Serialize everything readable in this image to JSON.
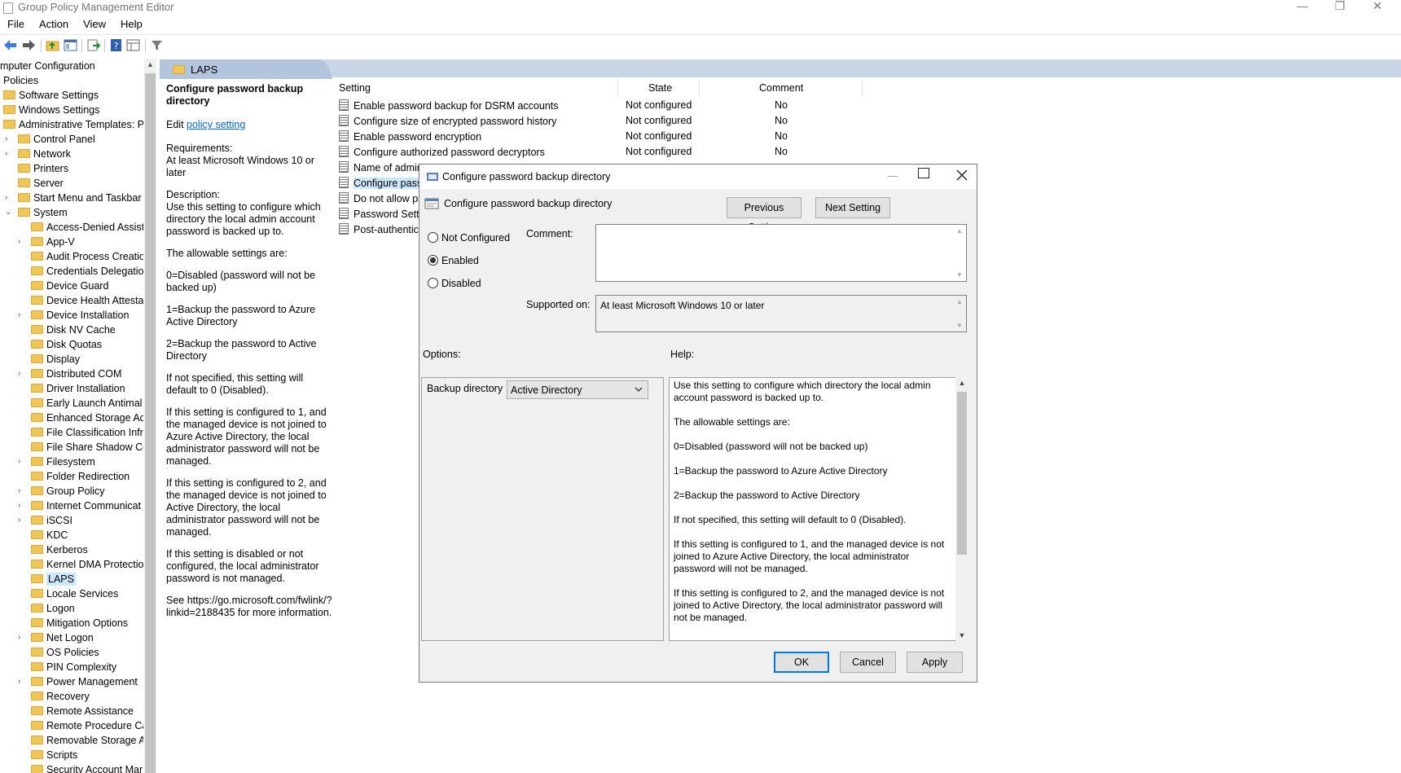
{
  "window": {
    "title": "Group Policy Management Editor",
    "minimize": "—",
    "restore": "❐",
    "close": "✕"
  },
  "menu": [
    "File",
    "Action",
    "View",
    "Help"
  ],
  "tree": {
    "root_items": [
      {
        "label": "mputer Configuration"
      },
      {
        "label": "Policies"
      },
      {
        "label": "Software Settings"
      },
      {
        "label": "Windows Settings"
      },
      {
        "label": "Administrative Templates: Po"
      }
    ],
    "level1": [
      {
        "label": "Control Panel",
        "expander": "›"
      },
      {
        "label": "Network",
        "expander": "›"
      },
      {
        "label": "Printers",
        "expander": ""
      },
      {
        "label": "Server",
        "expander": ""
      },
      {
        "label": "Start Menu and Taskbar",
        "expander": "›"
      },
      {
        "label": "System",
        "expander": "⌄"
      }
    ],
    "system_children": [
      {
        "label": "Access-Denied Assista",
        "expander": ""
      },
      {
        "label": "App-V",
        "expander": "›"
      },
      {
        "label": "Audit Process Creatio",
        "expander": ""
      },
      {
        "label": "Credentials Delegatio",
        "expander": ""
      },
      {
        "label": "Device Guard",
        "expander": ""
      },
      {
        "label": "Device Health Attesta",
        "expander": ""
      },
      {
        "label": "Device Installation",
        "expander": "›"
      },
      {
        "label": "Disk NV Cache",
        "expander": ""
      },
      {
        "label": "Disk Quotas",
        "expander": ""
      },
      {
        "label": "Display",
        "expander": ""
      },
      {
        "label": "Distributed COM",
        "expander": "›"
      },
      {
        "label": "Driver Installation",
        "expander": ""
      },
      {
        "label": "Early Launch Antimal",
        "expander": ""
      },
      {
        "label": "Enhanced Storage Ac",
        "expander": ""
      },
      {
        "label": "File Classification Infr",
        "expander": ""
      },
      {
        "label": "File Share Shadow Co",
        "expander": ""
      },
      {
        "label": "Filesystem",
        "expander": "›"
      },
      {
        "label": "Folder Redirection",
        "expander": ""
      },
      {
        "label": "Group Policy",
        "expander": "›"
      },
      {
        "label": "Internet Communicat",
        "expander": "›"
      },
      {
        "label": "iSCSI",
        "expander": "›"
      },
      {
        "label": "KDC",
        "expander": ""
      },
      {
        "label": "Kerberos",
        "expander": ""
      },
      {
        "label": "Kernel DMA Protectio",
        "expander": ""
      },
      {
        "label": "LAPS",
        "expander": "",
        "selected": true
      },
      {
        "label": "Locale Services",
        "expander": ""
      },
      {
        "label": "Logon",
        "expander": ""
      },
      {
        "label": "Mitigation Options",
        "expander": ""
      },
      {
        "label": "Net Logon",
        "expander": "›"
      },
      {
        "label": "OS Policies",
        "expander": ""
      },
      {
        "label": "PIN Complexity",
        "expander": ""
      },
      {
        "label": "Power Management",
        "expander": "›"
      },
      {
        "label": "Recovery",
        "expander": ""
      },
      {
        "label": "Remote Assistance",
        "expander": ""
      },
      {
        "label": "Remote Procedure Ca",
        "expander": ""
      },
      {
        "label": "Removable Storage A",
        "expander": ""
      },
      {
        "label": "Scripts",
        "expander": ""
      },
      {
        "label": "Security Account Mar",
        "expander": ""
      }
    ]
  },
  "pane": {
    "header": "LAPS",
    "desc": {
      "title": "Configure password backup directory",
      "edit_prefix": "Edit ",
      "edit_link": "policy setting ",
      "requirements_label": "Requirements:",
      "requirements": "At least Microsoft Windows 10 or later",
      "description_label": "Description:",
      "description": "Use this setting to configure which directory the local admin account password is backed up to.",
      "p1": "The allowable settings are:",
      "p2": "0=Disabled (password will not be backed up)",
      "p3": "1=Backup the password to Azure Active Directory",
      "p4": "2=Backup the password to Active Directory",
      "p5": "If not specified, this setting will default to 0 (Disabled).",
      "p6": "If this setting is configured to 1, and the managed device is not joined to Azure Active Directory, the local administrator password will not be managed.",
      "p7": "If this setting is configured to 2, and the managed device is not joined to Active Directory, the local administrator password will not be managed.",
      "p8": "If this setting is disabled or not configured, the local administrator password is not managed.",
      "p9": "See https://go.microsoft.com/fwlink/?linkid=2188435 for more information."
    },
    "columns": {
      "setting": "Setting",
      "state": "State",
      "comment": "Comment"
    },
    "rows": [
      {
        "setting": "Enable password backup for DSRM accounts",
        "state": "Not configured",
        "comment": "No"
      },
      {
        "setting": "Configure size of encrypted password history",
        "state": "Not configured",
        "comment": "No"
      },
      {
        "setting": "Enable password encryption",
        "state": "Not configured",
        "comment": "No"
      },
      {
        "setting": "Configure authorized password decryptors",
        "state": "Not configured",
        "comment": "No"
      },
      {
        "setting": "Name of admir",
        "state": "",
        "comment": ""
      },
      {
        "setting": "Configure pass",
        "state": "",
        "comment": ""
      },
      {
        "setting": "Do not allow pa",
        "state": "",
        "comment": ""
      },
      {
        "setting": "Password Settir",
        "state": "",
        "comment": ""
      },
      {
        "setting": "Post-authentica",
        "state": "",
        "comment": ""
      }
    ]
  },
  "dialog": {
    "title": "Configure password backup directory",
    "heading": "Configure password backup directory",
    "prev_button": "Previous Setting",
    "next_button": "Next Setting",
    "radio_not_configured": "Not Configured",
    "radio_enabled": "Enabled",
    "radio_disabled": "Disabled",
    "selected_state": "Enabled",
    "comment_label": "Comment:",
    "supported_label": "Supported on:",
    "supported_value": "At least Microsoft Windows 10 or later",
    "options_label": "Options:",
    "help_label": "Help:",
    "backup_dir_label": "Backup directory",
    "backup_dir_value": "Active Directory",
    "help_text": [
      "Use this setting to configure which directory the local admin account password is backed up to.",
      "The allowable settings are:",
      "0=Disabled (password will not be backed up)",
      "1=Backup the password to Azure Active Directory",
      "2=Backup the password to Active Directory",
      "If not specified, this setting will default to 0 (Disabled).",
      "If this setting is configured to 1, and the managed device is not joined to Azure Active Directory, the local administrator password will not be managed.",
      "If this setting is configured to 2, and the managed device is not joined to Active Directory, the local administrator password will not be managed."
    ],
    "ok_button": "OK",
    "cancel_button": "Cancel",
    "apply_button": "Apply"
  },
  "colors": {
    "header_band": "#c9d6e6",
    "selection": "#cce8ff",
    "link": "#0066cc",
    "ok_border": "#0078d7"
  }
}
